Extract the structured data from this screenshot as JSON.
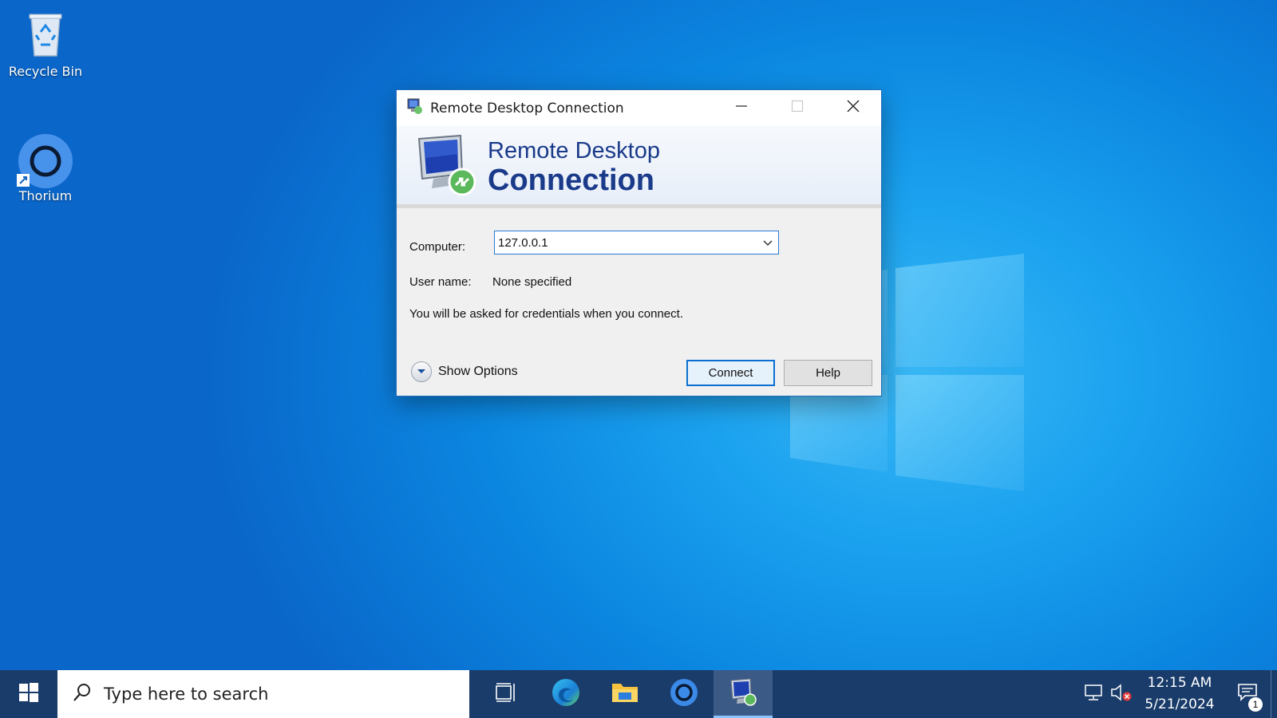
{
  "desktop": {
    "icons": [
      {
        "label": "Recycle Bin",
        "icon": "recycle-bin-icon"
      },
      {
        "label": "Thorium",
        "icon": "thorium-icon"
      }
    ]
  },
  "dialog": {
    "title": "Remote Desktop Connection",
    "banner_line1": "Remote Desktop",
    "banner_line2": "Connection",
    "computer_label": "Computer:",
    "computer_value": "127.0.0.1",
    "username_label": "User name:",
    "username_value": "None specified",
    "info_text": "You will be asked for credentials when you connect.",
    "show_options_label": "Show Options",
    "connect_label": "Connect",
    "help_label": "Help"
  },
  "taskbar": {
    "search_placeholder": "Type here to search",
    "apps": [
      "task-view-icon",
      "edge-icon",
      "file-explorer-icon",
      "thorium-icon",
      "remote-desktop-icon"
    ],
    "time": "12:15 AM",
    "date": "5/21/2024",
    "notification_count": "1"
  },
  "colors": {
    "desktop_blue": "#0b86e0",
    "taskbar": "#1a3c6a",
    "banner_text": "#1a3a8a",
    "accent": "#0a6fd0"
  }
}
